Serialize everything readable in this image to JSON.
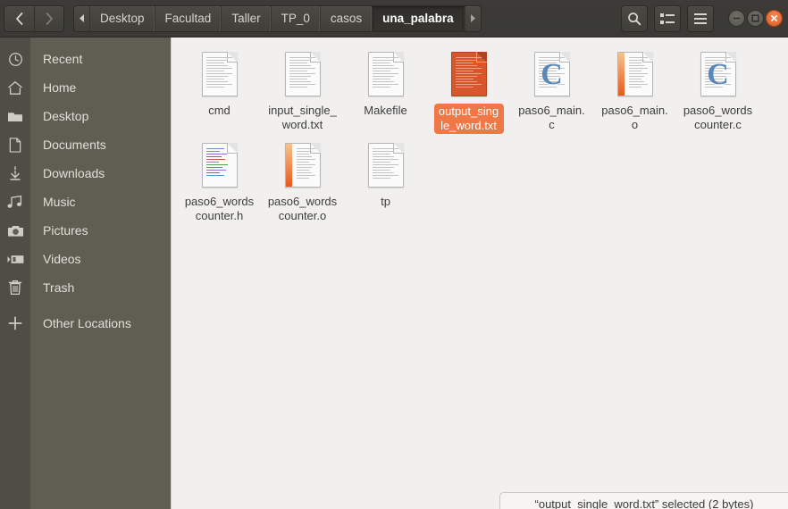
{
  "header": {
    "nav": {
      "back": "back-arrow",
      "forward": "forward-arrow"
    },
    "breadcrumb_scroll_left": "left-arrow",
    "breadcrumb_scroll_right": "right-arrow",
    "breadcrumbs": [
      {
        "label": "Desktop",
        "active": false
      },
      {
        "label": "Facultad",
        "active": false
      },
      {
        "label": "Taller",
        "active": false
      },
      {
        "label": "TP_0",
        "active": false
      },
      {
        "label": "casos",
        "active": false
      },
      {
        "label": "una_palabra",
        "active": true
      }
    ],
    "buttons": [
      {
        "name": "search-button",
        "icon": "search-icon"
      },
      {
        "name": "view-options-button",
        "icon": "list-view-icon"
      },
      {
        "name": "menu-button",
        "icon": "hamburger-icon"
      }
    ],
    "window_controls": [
      {
        "name": "minimize-button",
        "icon": "minimize-icon"
      },
      {
        "name": "maximize-button",
        "icon": "maximize-icon"
      },
      {
        "name": "close-button",
        "icon": "close-icon"
      }
    ]
  },
  "sidebar": {
    "items": [
      {
        "label": "Recent",
        "icon": "clock-icon"
      },
      {
        "label": "Home",
        "icon": "home-icon"
      },
      {
        "label": "Desktop",
        "icon": "folder-icon"
      },
      {
        "label": "Documents",
        "icon": "document-icon"
      },
      {
        "label": "Downloads",
        "icon": "download-arrow-icon"
      },
      {
        "label": "Music",
        "icon": "music-note-icon"
      },
      {
        "label": "Pictures",
        "icon": "camera-icon"
      },
      {
        "label": "Videos",
        "icon": "video-camera-icon"
      },
      {
        "label": "Trash",
        "icon": "trash-icon"
      },
      {
        "label": "Other Locations",
        "icon": "plus-icon"
      }
    ]
  },
  "files": [
    {
      "name": "cmd",
      "type": "text",
      "selected": false
    },
    {
      "name": "input_single_word.txt",
      "type": "text",
      "selected": false
    },
    {
      "name": "Makefile",
      "type": "text",
      "selected": false
    },
    {
      "name": "output_single_word.txt",
      "type": "text-sel",
      "selected": true
    },
    {
      "name": "paso6_main.c",
      "type": "csource",
      "selected": false
    },
    {
      "name": "paso6_main.o",
      "type": "object",
      "selected": false
    },
    {
      "name": "paso6_wordscounter.c",
      "type": "csource",
      "selected": false
    },
    {
      "name": "paso6_wordscounter.h",
      "type": "header",
      "selected": false
    },
    {
      "name": "paso6_wordscounter.o",
      "type": "object",
      "selected": false
    },
    {
      "name": "tp",
      "type": "text",
      "selected": false
    }
  ],
  "statusbar": {
    "text": "“output_single_word.txt” selected (2 bytes)"
  },
  "colors": {
    "accent_orange": "#f07746",
    "header_bg": "#3a3935",
    "sidebar_bg": "#5f5e53",
    "sidebar_strip_bg": "#4e4e47",
    "content_bg": "#f1f0ee",
    "close_button": "#dd5a20"
  }
}
